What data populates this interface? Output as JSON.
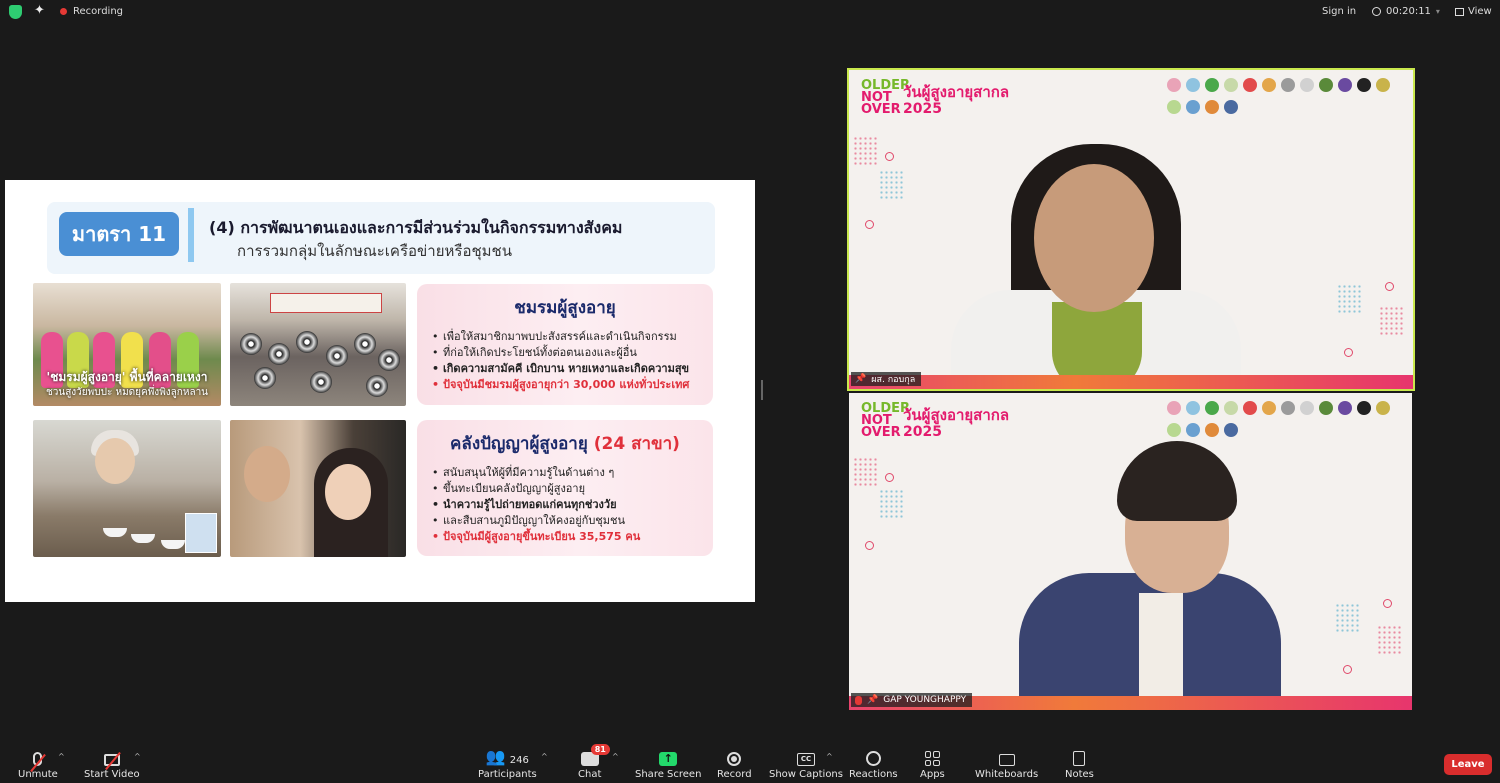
{
  "topbar": {
    "recording_label": "Recording",
    "sign_in": "Sign in",
    "timer": "00:20:11",
    "view_label": "View"
  },
  "slide": {
    "section_tag": "มาตรา 11",
    "title": "(4) การพัฒนาตนเองและการมีส่วนร่วมในกิจกรรมทางสังคม",
    "subtitle": "การรวมกลุ่มในลักษณะเครือข่ายหรือชุมชน",
    "photo1_caption_line1": "'ชมรมผู้สูงอายุ' พื้นที่คลายเหงา",
    "photo1_caption_line2": "ชวนสูงวัยพบปะ หมดยุคพึ่งพิงลูกหลาน",
    "card1": {
      "title": "ชมรมผู้สูงอายุ",
      "items": [
        "เพื่อให้สมาชิกมาพบปะสังสรรค์และดำเนินกิจกรรม",
        "ที่ก่อให้เกิดประโยชน์ทั้งต่อตนเองและผู้อื่น",
        "เกิดความสามัคคี เบิกบาน หายเหงาและเกิดความสุข",
        "ปัจจุบันมีชมรมผู้สูงอายุกว่า 30,000 แห่งทั่วประเทศ"
      ]
    },
    "card2": {
      "title": "คลังปัญญาผู้สูงอายุ",
      "title_suffix": "(24 สาขา)",
      "items": [
        "สนับสนุนให้ผู้ที่มีความรู้ในด้านต่าง ๆ",
        "ขึ้นทะเบียนคลังปัญญาผู้สูงอายุ",
        "นำความรู้ไปถ่ายทอดแก่คนทุกช่วงวัย",
        "และสืบสานภูมิปัญญาให้คงอยู่กับชุมชน",
        "ปัจจุบันมีผู้สูงอายุขึ้นทะเบียน 35,575 คน"
      ]
    }
  },
  "event_banner": {
    "older": "OLDER",
    "not": "NOT",
    "over": "OVER",
    "title": "วันผู้สูงอายุสากล",
    "year": "2025"
  },
  "participants_video": [
    {
      "name": "ผส. กอบกุล"
    },
    {
      "name": "GAP YOUNGHAPPY"
    }
  ],
  "toolbar": {
    "unmute": "Unmute",
    "start_video": "Start Video",
    "participants": "Participants",
    "participants_count": "246",
    "chat": "Chat",
    "chat_badge": "81",
    "share_screen": "Share Screen",
    "record": "Record",
    "show_captions": "Show Captions",
    "captions_icon_text": "CC",
    "reactions": "Reactions",
    "apps": "Apps",
    "whiteboards": "Whiteboards",
    "notes": "Notes",
    "leave": "Leave"
  },
  "colors": {
    "accent_green": "#23d96b",
    "leave_red": "#d92d2d",
    "active_speaker_border": "#c9e84d",
    "slide_blue": "#4a8fd4",
    "brand_pink": "#e31b6d"
  }
}
